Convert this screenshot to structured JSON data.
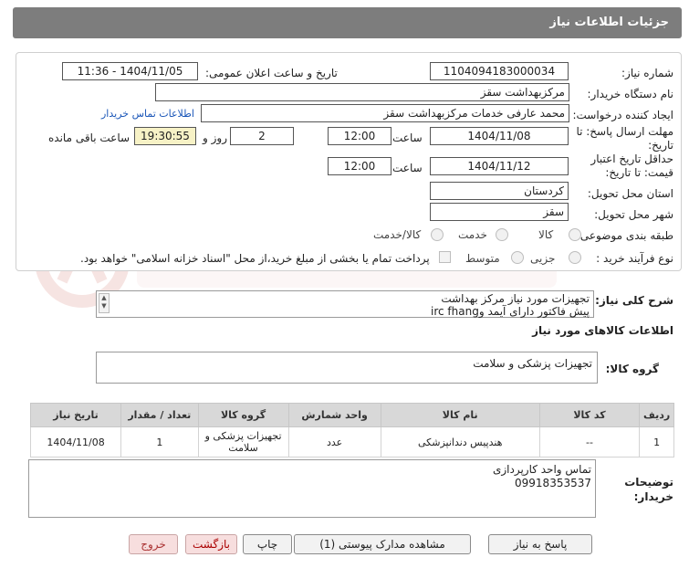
{
  "header": {
    "title": "جزئیات اطلاعات نیاز"
  },
  "form": {
    "need_number_label": "شماره نیاز:",
    "need_number": "1104094183000034",
    "announce_label": "تاریخ و ساعت اعلان عمومی:",
    "announce_value": "1404/11/05 - 11:36",
    "buyer_org_label": "نام دستگاه خریدار:",
    "buyer_org": "مرکزبهداشت سقز",
    "creator_label": "ایجاد کننده درخواست:",
    "creator": "محمد عارفی خدمات مرکزبهداشت سقز",
    "contact_link": "اطلاعات تماس خریدار",
    "reply_deadline_label": "مهلت ارسال پاسخ: تا تاریخ:",
    "reply_date": "1404/11/08",
    "time_label": "ساعت",
    "reply_time": "12:00",
    "days_value": "2",
    "days_and_label": "روز و",
    "remaining_time": "19:30:55",
    "remaining_label": "ساعت باقی مانده",
    "validity_label": "حداقل تاریخ اعتبار قیمت: تا تاریخ:",
    "validity_date": "1404/11/12",
    "validity_time": "12:00",
    "province_label": "استان محل تحویل:",
    "province": "کردستان",
    "city_label": "شهر محل تحویل:",
    "city": "سقز",
    "category_label": "طبقه بندی موضوعی:",
    "category_options": [
      "کالا",
      "خدمت",
      "کالا/خدمت"
    ],
    "process_label": "نوع فرآیند خرید :",
    "process_options": [
      "جزیی",
      "متوسط"
    ],
    "payment_note": "پرداخت تمام یا بخشی از مبلغ خرید،از محل \"اسناد خزانه اسلامی\" خواهد بود."
  },
  "description": {
    "label": "شرح کلی نیاز:",
    "line1": "تجهیزات مورد نیاز مرکز بهداشت",
    "line2": "پیش فاکتور دارای آیمد وirc fhang"
  },
  "goods": {
    "section_title": "اطلاعات کالاهای مورد نیاز",
    "group_label": "گروه کالا:",
    "group_value": "تجهیزات پزشکی و سلامت",
    "columns": [
      "ردیف",
      "کد کالا",
      "نام کالا",
      "واحد شمارش",
      "گروه کالا",
      "تعداد / مقدار",
      "تاریخ نیاز"
    ],
    "rows": [
      {
        "index": "1",
        "code": "--",
        "name": "هندپیس دندانپزشکی",
        "unit": "عدد",
        "group": "تجهیزات پزشکی و سلامت",
        "qty": "1",
        "date": "1404/11/08"
      }
    ]
  },
  "notes": {
    "label": "توضیحات خریدار:",
    "line1": "تماس واحد کارپردازی",
    "line2": "09918353537"
  },
  "buttons": {
    "reply": "پاسخ به نیاز",
    "docs": "مشاهده مدارک پیوستی (1)",
    "print": "چاپ",
    "back": "بازگشت",
    "exit": "خروج"
  }
}
